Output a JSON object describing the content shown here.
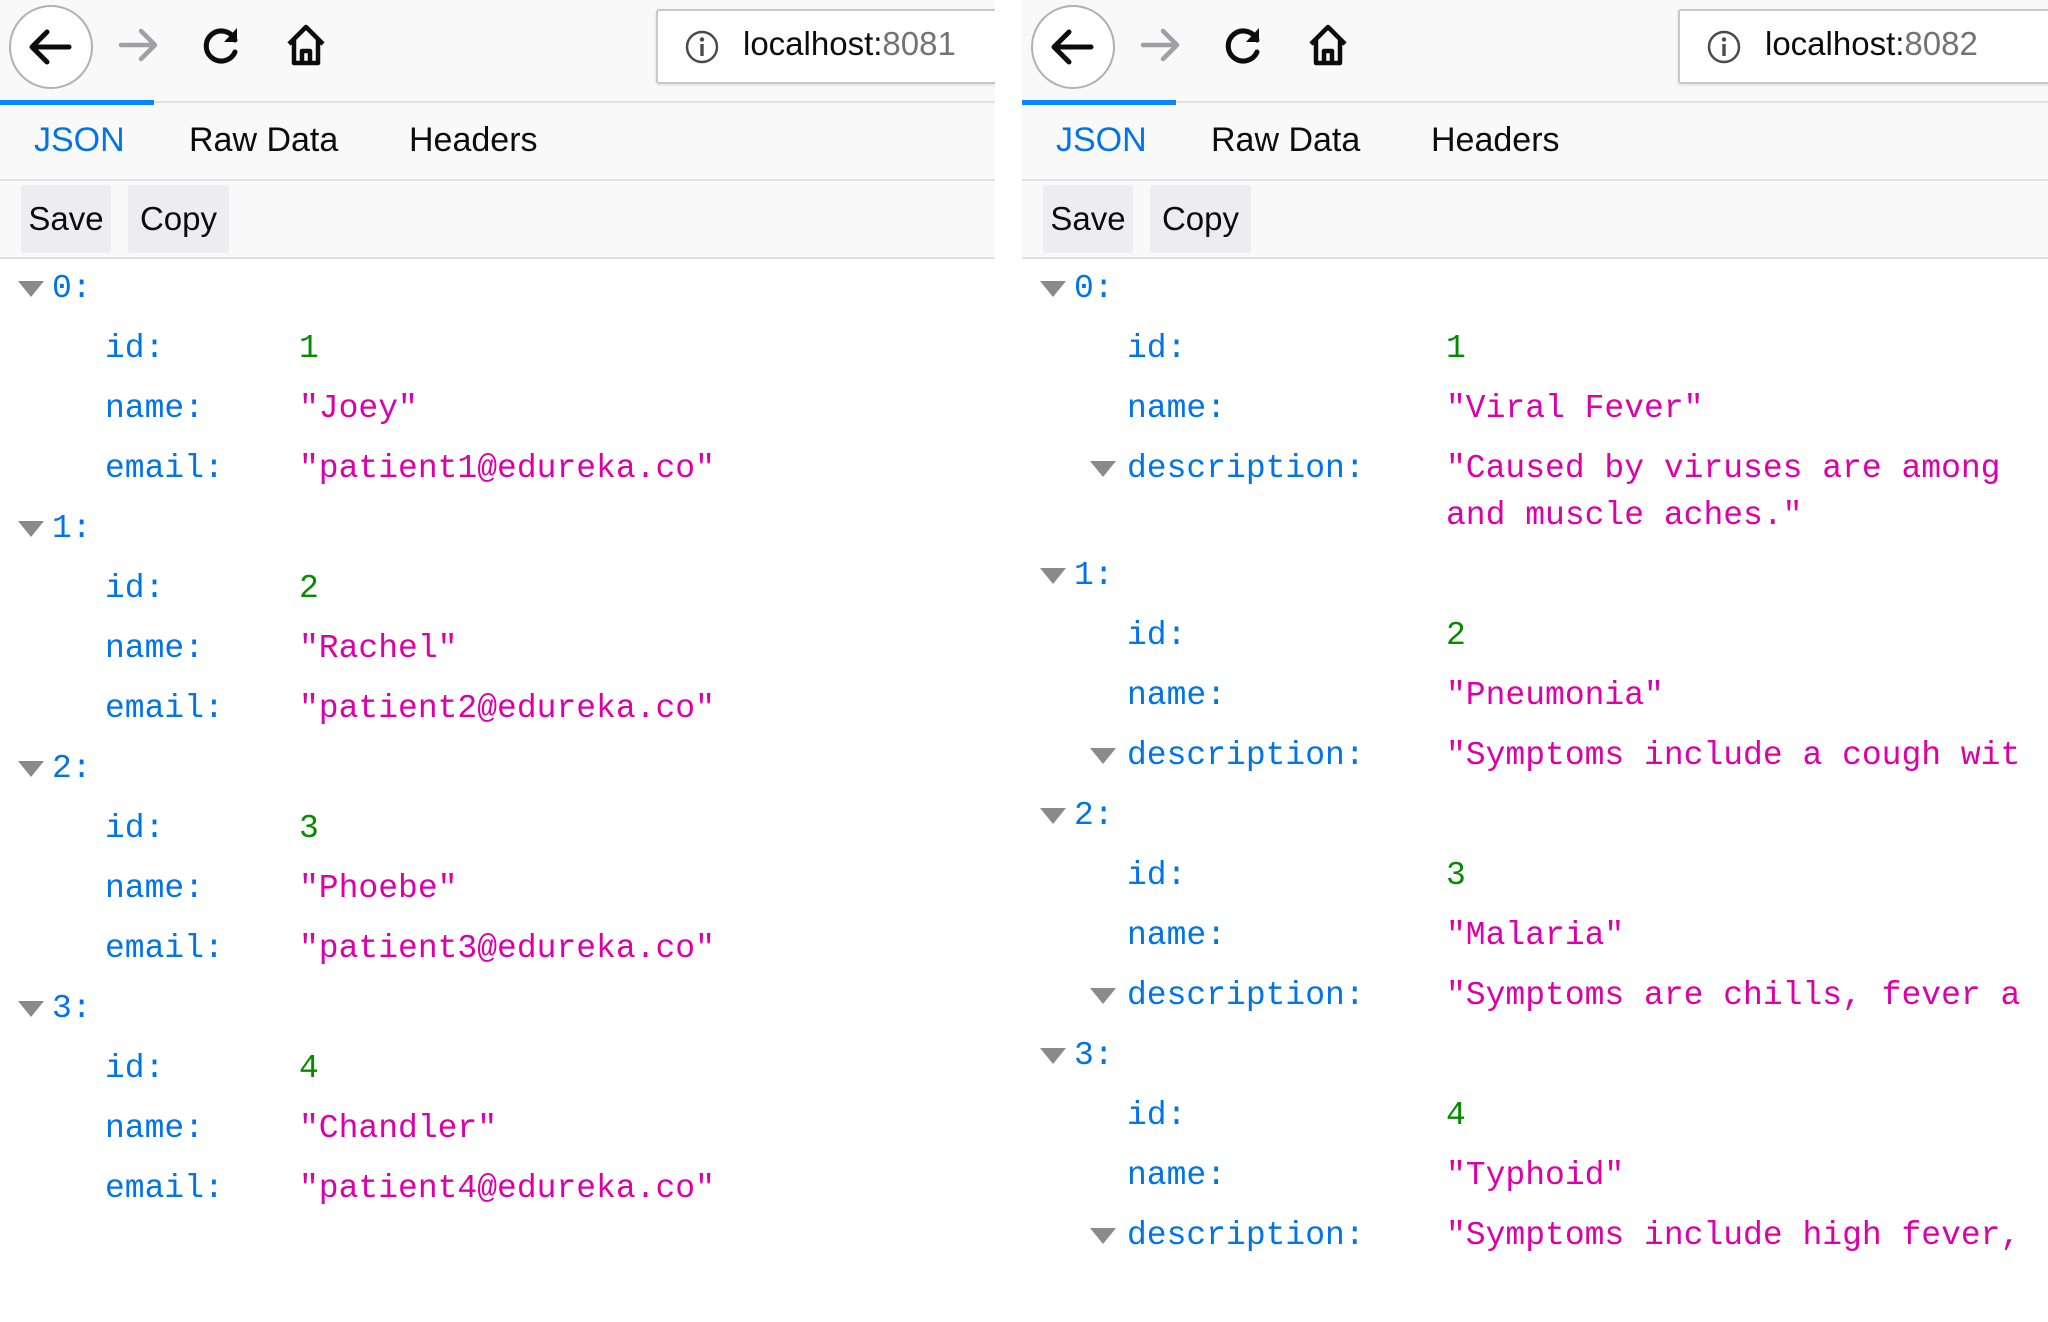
{
  "colors": {
    "key": "#0074e8",
    "string": "#dd00a9",
    "number": "#058b00",
    "active_tab": "#0074e8"
  },
  "panels": [
    {
      "id": "left",
      "url": {
        "host": "localhost:",
        "port": "8081"
      },
      "tabs": [
        {
          "label": "JSON",
          "active": true
        },
        {
          "label": "Raw Data",
          "active": false
        },
        {
          "label": "Headers",
          "active": false
        }
      ],
      "actions": {
        "save": "Save",
        "copy": "Copy"
      },
      "items": [
        {
          "index": "0:",
          "fields": [
            {
              "key": "id:",
              "value": "1",
              "type": "number"
            },
            {
              "key": "name:",
              "value": "\"Joey\"",
              "type": "string"
            },
            {
              "key": "email:",
              "value": "\"patient1@edureka.co\"",
              "type": "string"
            }
          ]
        },
        {
          "index": "1:",
          "fields": [
            {
              "key": "id:",
              "value": "2",
              "type": "number"
            },
            {
              "key": "name:",
              "value": "\"Rachel\"",
              "type": "string"
            },
            {
              "key": "email:",
              "value": "\"patient2@edureka.co\"",
              "type": "string"
            }
          ]
        },
        {
          "index": "2:",
          "fields": [
            {
              "key": "id:",
              "value": "3",
              "type": "number"
            },
            {
              "key": "name:",
              "value": "\"Phoebe\"",
              "type": "string"
            },
            {
              "key": "email:",
              "value": "\"patient3@edureka.co\"",
              "type": "string"
            }
          ]
        },
        {
          "index": "3:",
          "fields": [
            {
              "key": "id:",
              "value": "4",
              "type": "number"
            },
            {
              "key": "name:",
              "value": "\"Chandler\"",
              "type": "string"
            },
            {
              "key": "email:",
              "value": "\"patient4@edureka.co\"",
              "type": "string"
            }
          ]
        }
      ]
    },
    {
      "id": "right",
      "url": {
        "host": "localhost:",
        "port": "8082"
      },
      "tabs": [
        {
          "label": "JSON",
          "active": true
        },
        {
          "label": "Raw Data",
          "active": false
        },
        {
          "label": "Headers",
          "active": false
        }
      ],
      "actions": {
        "save": "Save",
        "copy": "Copy"
      },
      "items": [
        {
          "index": "0:",
          "fields": [
            {
              "key": "id:",
              "value": "1",
              "type": "number"
            },
            {
              "key": "name:",
              "value": "\"Viral Fever\"",
              "type": "string"
            },
            {
              "key": "description:",
              "value": "\"Caused by viruses are among",
              "continuation": "and muscle aches.\"",
              "type": "string",
              "expandable": true
            }
          ]
        },
        {
          "index": "1:",
          "fields": [
            {
              "key": "id:",
              "value": "2",
              "type": "number"
            },
            {
              "key": "name:",
              "value": "\"Pneumonia\"",
              "type": "string"
            },
            {
              "key": "description:",
              "value": "\"Symptoms include a cough wit",
              "type": "string",
              "expandable": true
            }
          ]
        },
        {
          "index": "2:",
          "fields": [
            {
              "key": "id:",
              "value": "3",
              "type": "number"
            },
            {
              "key": "name:",
              "value": "\"Malaria\"",
              "type": "string"
            },
            {
              "key": "description:",
              "value": "\"Symptoms are chills, fever a",
              "type": "string",
              "expandable": true
            }
          ]
        },
        {
          "index": "3:",
          "fields": [
            {
              "key": "id:",
              "value": "4",
              "type": "number"
            },
            {
              "key": "name:",
              "value": "\"Typhoid\"",
              "type": "string"
            },
            {
              "key": "description:",
              "value": "\"Symptoms include high fever,",
              "type": "string",
              "expandable": true
            }
          ]
        }
      ]
    }
  ]
}
